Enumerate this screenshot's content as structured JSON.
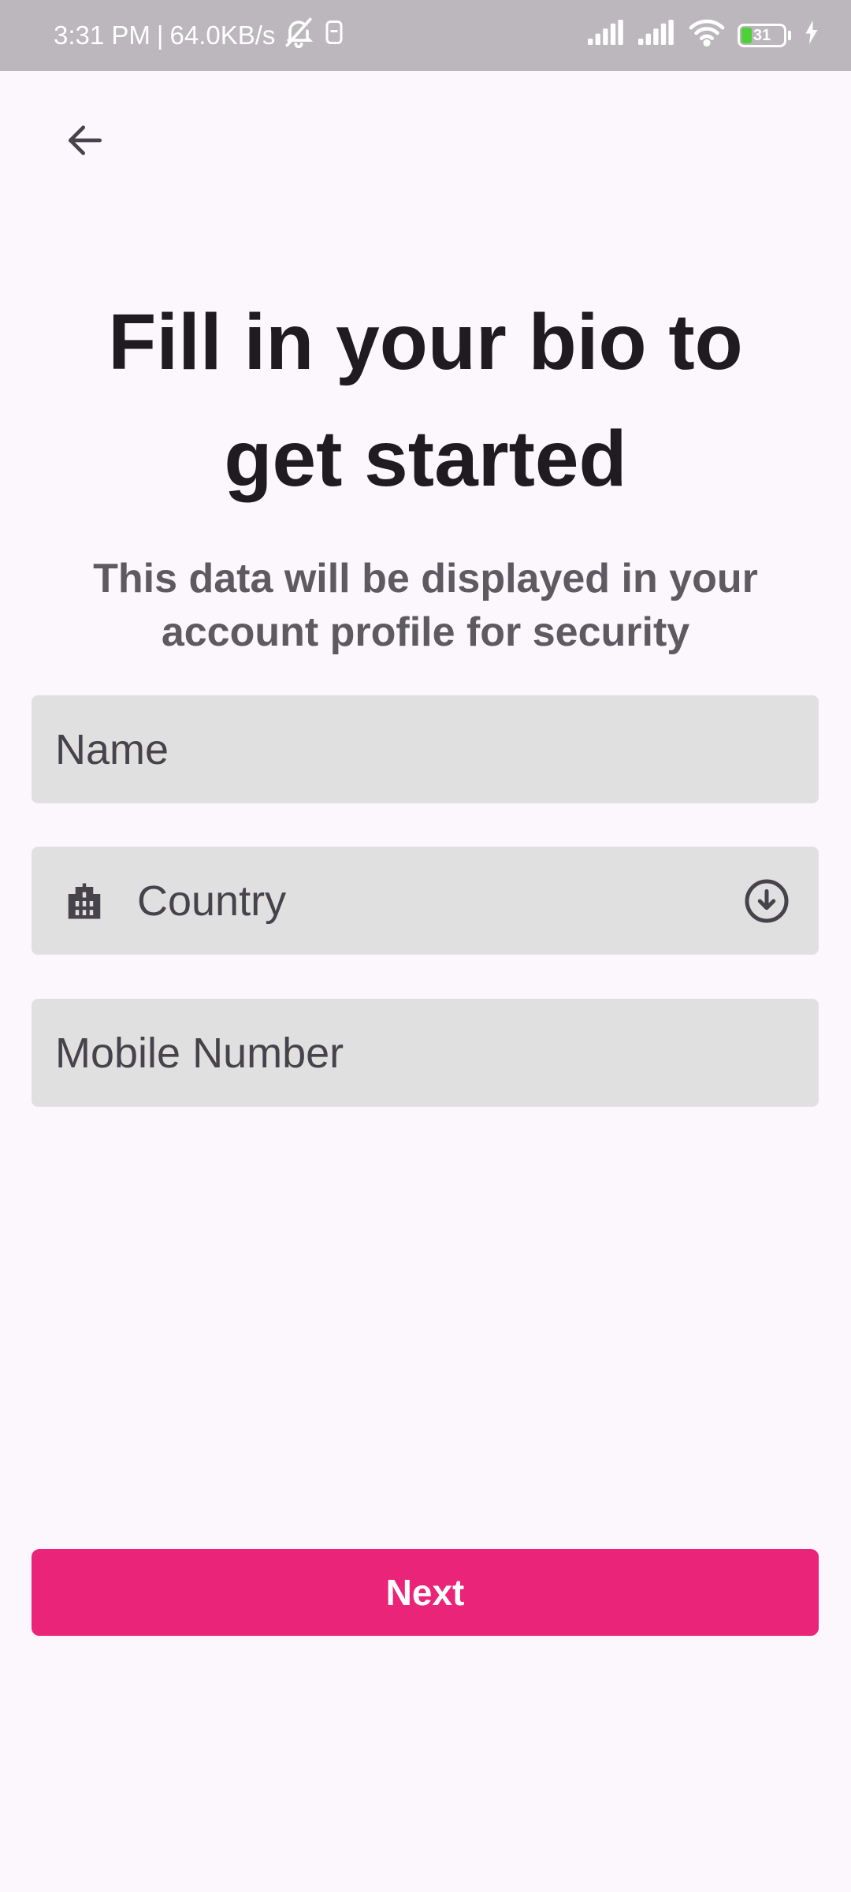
{
  "status_bar": {
    "time": "3:31 PM",
    "separator": "|",
    "network_speed": "64.0KB/s",
    "battery_percent": 31,
    "battery_label": "31",
    "icons": [
      "mute-bell-icon",
      "sim-icon",
      "signal-icon",
      "signal-icon",
      "wifi-icon",
      "battery-icon",
      "charging-icon"
    ]
  },
  "header": {
    "back_icon": "arrow-left-icon"
  },
  "main": {
    "title_line1": "Fill in your bio to",
    "title_line2": "get started",
    "subtitle_line1": "This data will be displayed in your",
    "subtitle_line2": "account profile for security"
  },
  "form": {
    "name_placeholder": "Name",
    "country_label": "Country",
    "country_icon": "building-icon",
    "country_dropdown_icon": "circle-arrow-down-icon",
    "mobile_placeholder": "Mobile Number"
  },
  "actions": {
    "next_label": "Next"
  },
  "colors": {
    "background": "#fcf6fd",
    "status_bar": "#bbb7bc",
    "field_bg": "#e1e0e1",
    "primary": "#ea2479",
    "title_text": "#1f1b21",
    "subtitle_text": "#5d5a60",
    "battery_fill": "#4cd137"
  }
}
